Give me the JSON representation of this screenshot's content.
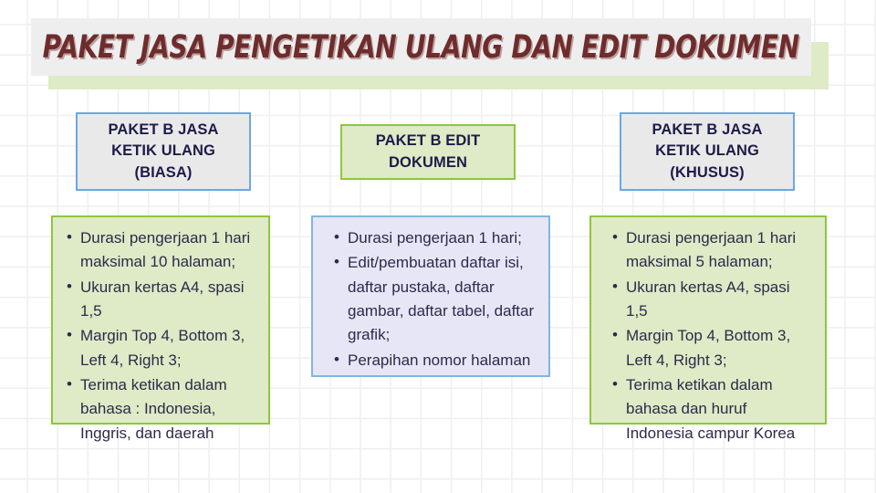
{
  "slide": {
    "title": "PAKET JASA PENGETIKAN ULANG DAN EDIT DOKUMEN",
    "colors": {
      "title_text": "#6e2c2c",
      "green_fill": "#dfeac6",
      "green_border": "#8dc63f",
      "blue_border": "#6ea8dc",
      "lavender_fill": "#e6e6f7",
      "lavender_border": "#7fb8dc",
      "gray_fill": "#e9e9e9",
      "body_text": "#2b2b4b"
    }
  },
  "columns": [
    {
      "header": {
        "lines": [
          "PAKET B JASA",
          "KETIK ULANG",
          "(BIASA)"
        ]
      },
      "bullets": [
        "Durasi pengerjaan 1 hari maksimal 10 halaman;",
        "Ukuran kertas A4, spasi 1,5",
        "Margin Top 4, Bottom 3, Left 4, Right 3;",
        "Terima ketikan dalam bahasa : Indonesia, Inggris, dan daerah"
      ]
    },
    {
      "header": {
        "lines": [
          "PAKET B EDIT",
          "DOKUMEN"
        ]
      },
      "bullets": [
        "Durasi pengerjaan 1 hari;",
        "Edit/pembuatan daftar isi, daftar pustaka, daftar gambar, daftar tabel, daftar grafik;",
        "Perapihan nomor halaman"
      ]
    },
    {
      "header": {
        "lines": [
          "PAKET B JASA",
          "KETIK ULANG",
          "(KHUSUS)"
        ]
      },
      "bullets": [
        "Durasi pengerjaan 1 hari maksimal 5 halaman;",
        "Ukuran kertas A4, spasi 1,5",
        "Margin Top 4, Bottom 3, Left 4, Right 3;",
        "Terima ketikan dalam bahasa dan huruf Indonesia campur Korea"
      ]
    }
  ]
}
